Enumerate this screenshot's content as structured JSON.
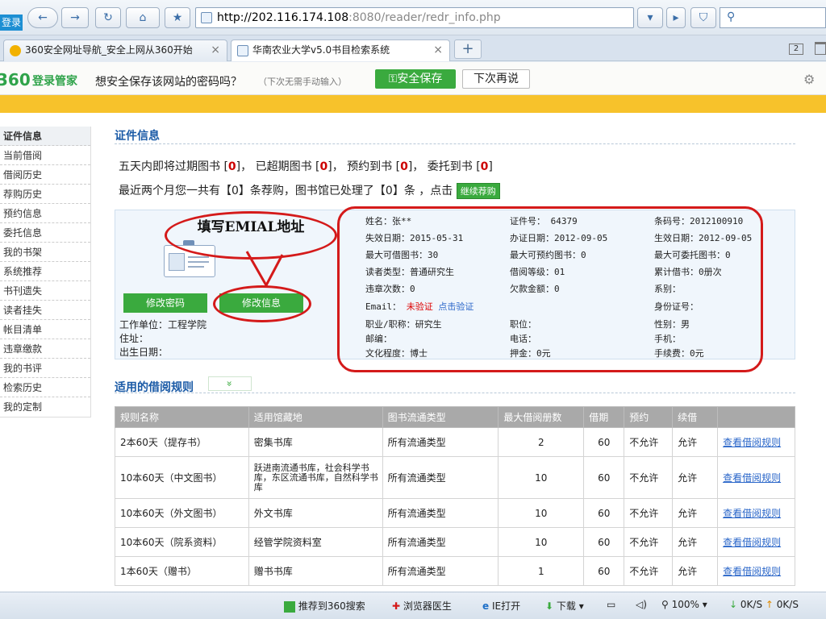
{
  "browser": {
    "login_tab": "登录",
    "url_main": "http://202.116.174.108",
    "url_rest": ":8080/reader/redr_info.php",
    "tabs": [
      {
        "label": "360安全网址导航_安全上网从360开始"
      },
      {
        "label": "华南农业大学v5.0书目检索系统"
      }
    ],
    "new_tab": "+"
  },
  "password_bar": {
    "logo": "360",
    "brand": "登录管家",
    "message": "想安全保存该网站的密码吗？",
    "hint": "（下次无需手动输入）",
    "save_label": "安全保存",
    "later_label": "下次再说"
  },
  "sidebar": {
    "items": [
      {
        "label": "证件信息"
      },
      {
        "label": "当前借阅"
      },
      {
        "label": "借阅历史"
      },
      {
        "label": "荐购历史"
      },
      {
        "label": "预约信息"
      },
      {
        "label": "委托信息"
      },
      {
        "label": "我的书架"
      },
      {
        "label": "系统推荐"
      },
      {
        "label": "书刊遗失"
      },
      {
        "label": "读者挂失"
      },
      {
        "label": "帐目清单"
      },
      {
        "label": "违章缴款"
      },
      {
        "label": "我的书评"
      },
      {
        "label": "检索历史"
      },
      {
        "label": "我的定制"
      }
    ]
  },
  "card_section": {
    "title": "证件信息",
    "notice_line1": {
      "p1": "五天内即将过期图书 [",
      "v1": "0",
      "p2": "]， 已超期图书 [",
      "v2": "0",
      "p3": "]， 预约到书 [",
      "v3": "0",
      "p4": "]，  委托到书 [",
      "v4": "0",
      "p5": "]"
    },
    "notice_line2": "最近两个月您一共有【0】条荐购，图书馆已处理了【0】条 ，点击",
    "recommend_btn": "继续荐购",
    "change_password": "修改密码",
    "edit_info": "修改信息",
    "work_unit": "工作单位：工程学院",
    "address": "住址：",
    "birth": "出生日期：",
    "callout": "填写EMIAL地址",
    "email_label": "Email：",
    "email_status": "未验证",
    "email_verify": "点击验证",
    "fields": {
      "name": "姓名：张**",
      "expire": "失效日期：2015-05-31",
      "max_borrow": "最大可借图书：30",
      "reader_type": "读者类型：普通研究生",
      "violations": "违章次数：0",
      "title": "职业/职称：研究生",
      "postcode": "邮编：",
      "education": "文化程度：博士",
      "card_no": "证件号： 64379",
      "issue_date": "办证日期：2012-09-05",
      "max_reserve": "最大可预约图书：0",
      "level": "借阅等级：01",
      "debt": "欠款金额：0",
      "position": "职位：",
      "phone": "电话：",
      "deposit": "押金：0元",
      "barcode": "条码号：2012100910",
      "effective": "生效日期：2012-09-05",
      "max_entrust": "最大可委托图书：0",
      "total": "累计借书：0册次",
      "department": "系别：",
      "id_no": "身份证号：",
      "gender": "性别：男",
      "mobile": "手机：",
      "fee": "手续费：0元"
    }
  },
  "rules_section": {
    "title": "适用的借阅规则",
    "toggle": "»",
    "headers": [
      "规则名称",
      "适用馆藏地",
      "图书流通类型",
      "最大借阅册数",
      "借期",
      "预约",
      "续借",
      ""
    ],
    "rows": [
      [
        "2本60天（提存书）",
        "密集书库",
        "所有流通类型",
        "2",
        "60",
        "不允许",
        "允许",
        "查看借阅规则"
      ],
      [
        "10本60天（中文图书）",
        "跃进南流通书库，社会科学书库，东区流通书库，自然科学书库",
        "所有流通类型",
        "10",
        "60",
        "不允许",
        "允许",
        "查看借阅规则"
      ],
      [
        "10本60天（外文图书）",
        "外文书库",
        "所有流通类型",
        "10",
        "60",
        "不允许",
        "允许",
        "查看借阅规则"
      ],
      [
        "10本60天（院系资料）",
        "经管学院资料室",
        "所有流通类型",
        "10",
        "60",
        "不允许",
        "允许",
        "查看借阅规则"
      ],
      [
        "1本60天（赠书）",
        "赠书书库",
        "所有流通类型",
        "1",
        "60",
        "不允许",
        "允许",
        "查看借阅规则"
      ]
    ]
  },
  "statusbar": {
    "recommend": "推荐到360搜索",
    "doctor": "浏览器医生",
    "ie": "IE打开",
    "download": "下载",
    "zoom": "100%",
    "speed_down": "0K/S",
    "speed_up": "0K/S"
  },
  "colors": {
    "accent_green": "#3aaa3e",
    "title_blue": "#1a5aa6",
    "annotation_red": "#d41a1a",
    "orange_bar": "#f7c22b"
  }
}
